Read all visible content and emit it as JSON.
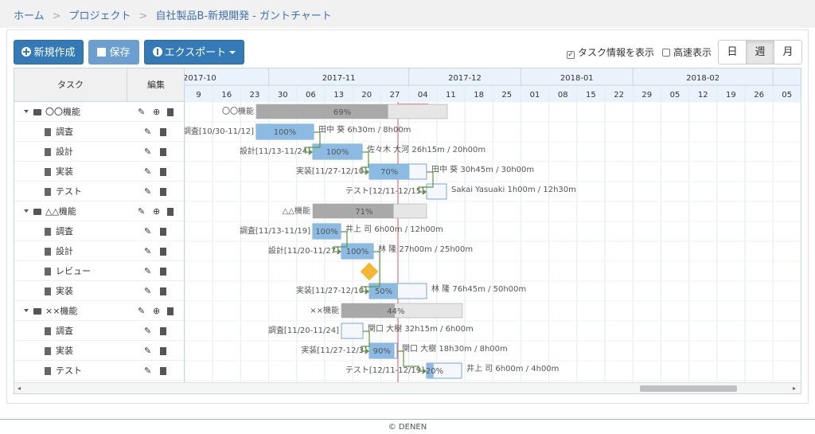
{
  "breadcrumb": [
    "ホーム",
    "プロジェクト",
    "自社製品B-新規開発 - ガントチャート"
  ],
  "toolbar": {
    "new_label": "新規作成",
    "save_label": "保存",
    "export_label": "エクスポート",
    "show_task_info": "タスク情報を表示",
    "fast_display": "高速表示",
    "views": [
      "日",
      "週",
      "月"
    ],
    "active_view": "週"
  },
  "grid": {
    "task_header": "タスク",
    "edit_header": "編集"
  },
  "tasks": [
    {
      "name": "〇〇機能",
      "group": true
    },
    {
      "name": "調査"
    },
    {
      "name": "設計"
    },
    {
      "name": "実装"
    },
    {
      "name": "テスト"
    },
    {
      "name": "△△機能",
      "group": true
    },
    {
      "name": "調査"
    },
    {
      "name": "設計"
    },
    {
      "name": "レビュー"
    },
    {
      "name": "実装"
    },
    {
      "name": "××機能",
      "group": true
    },
    {
      "name": "調査"
    },
    {
      "name": "実装"
    },
    {
      "name": "テスト"
    }
  ],
  "timeline": {
    "months": [
      "2017-10",
      "2017-11",
      "2017-12",
      "2018-01",
      "2018-02"
    ],
    "weeks": [
      "9",
      "16",
      "23",
      "30",
      "06",
      "13",
      "20",
      "27",
      "04",
      "11",
      "18",
      "25",
      "01",
      "08",
      "15",
      "22",
      "29",
      "05",
      "12",
      "19",
      "26",
      "05"
    ],
    "today_label": "Today"
  },
  "bars": [
    {
      "label": "〇〇機能",
      "pct": "69%",
      "info": ""
    },
    {
      "label": "調査[10/30-11/12]",
      "pct": "100%",
      "info": "田中 葵 6h30m / 8h00m"
    },
    {
      "label": "設計[11/13-11/24]",
      "pct": "100%",
      "info": "佐々木 大河 26h15m / 20h00m"
    },
    {
      "label": "実装[11/27-12/10]",
      "pct": "70%",
      "info": "田中 葵 30h45m / 30h00m"
    },
    {
      "label": "テスト[12/11-12/15]",
      "pct": "",
      "info": "Sakai Yasuaki 1h00m / 12h30m"
    },
    {
      "label": "△△機能",
      "pct": "71%",
      "info": ""
    },
    {
      "label": "調査[11/13-11/19]",
      "pct": "100%",
      "info": "井上 司 6h00m / 12h00m"
    },
    {
      "label": "設計[11/20-11/27]",
      "pct": "100%",
      "info": "林 隆 27h00m / 25h00m"
    },
    {
      "label": "",
      "pct": "",
      "info": ""
    },
    {
      "label": "実装[11/27-12/10]",
      "pct": "50%",
      "info": "林 隆 76h45m / 50h00m"
    },
    {
      "label": "××機能",
      "pct": "44%",
      "info": ""
    },
    {
      "label": "調査[11/20-11/24]",
      "pct": "",
      "info": "関口 大樹 32h15m / 6h00m"
    },
    {
      "label": "実装[11/27-12/3]",
      "pct": "90%",
      "info": "関口 大樹 18h30m / 8h00m"
    },
    {
      "label": "テスト[12/11-12/19]",
      "pct": "20%",
      "info": "井上 司 6h00m / 4h00m"
    }
  ],
  "footer": "© DENEN",
  "colors": {
    "accent": "#337ab7",
    "bar": "#8bbbe3",
    "summary": "#a9a9a9",
    "today": "#e05a5a",
    "milestone": "#f5b731",
    "link": "#5a9a3a"
  }
}
